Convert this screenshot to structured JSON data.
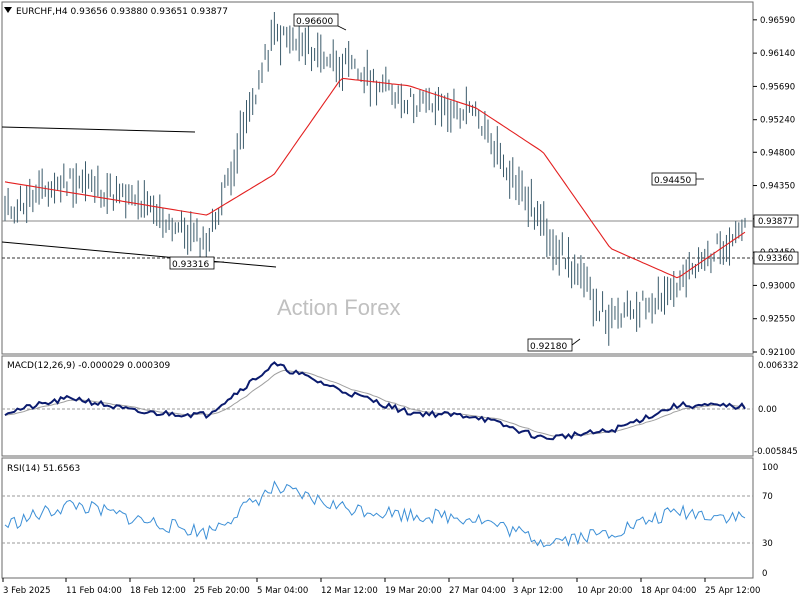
{
  "colors": {
    "price": "#3a5a6a",
    "ma": "#e32020",
    "macd": "#0b1b6e",
    "signal": "#a0a0a0",
    "rsi": "#3c8fd6",
    "trendline": "#000000",
    "refline": "#8a8a8a",
    "border": "#6a6a6a"
  },
  "header": {
    "symbol_line": "EURCHF,H4  0.93656 0.93880 0.93651 0.93877"
  },
  "watermark": "Action Forex",
  "price_axis": {
    "ticks": [
      "0.96590",
      "0.96140",
      "0.95690",
      "0.95240",
      "0.94800",
      "0.94350",
      "0.93900",
      "0.93450",
      "0.93000",
      "0.92550",
      "0.92100"
    ]
  },
  "annotations": {
    "high1": "0.96600",
    "high2": "0.94450",
    "low1": "0.93316",
    "low2": "0.92180",
    "current": "0.93877",
    "level": "0.93360"
  },
  "macd": {
    "label": "MACD(12,26,9) -0.000029 0.000309",
    "ticks": [
      "0.006332",
      "0.00",
      "-0.005845"
    ]
  },
  "rsi": {
    "label": "RSI(14) 51.6563",
    "ticks": [
      "100",
      "70",
      "30",
      "0"
    ]
  },
  "time_axis": {
    "ticks": [
      "3 Feb 2025",
      "11 Feb 04:00",
      "18 Feb 12:00",
      "25 Feb 20:00",
      "5 Mar 04:00",
      "12 Mar 12:00",
      "19 Mar 20:00",
      "27 Mar 04:00",
      "3 Apr 12:00",
      "10 Apr 20:00",
      "18 Apr 04:00",
      "25 Apr 12:00"
    ]
  },
  "chart_data": {
    "type": "line",
    "title": "EURCHF,H4",
    "x": [
      "3 Feb 2025",
      "11 Feb 04:00",
      "18 Feb 12:00",
      "25 Feb 20:00",
      "5 Mar 04:00",
      "12 Mar 12:00",
      "19 Mar 20:00",
      "27 Mar 04:00",
      "3 Apr 12:00",
      "10 Apr 20:00",
      "18 Apr 04:00",
      "25 Apr 12:00"
    ],
    "ylim": [
      0.921,
      0.9675
    ],
    "series": [
      {
        "values": [
          0.94,
          0.9445,
          0.941,
          0.9355,
          0.964,
          0.96,
          0.955,
          0.953,
          0.938,
          0.925,
          0.93,
          0.9385
        ]
      }
    ],
    "ma_values": [
      0.944,
      0.9425,
      0.941,
      0.9395,
      0.945,
      0.958,
      0.957,
      0.954,
      0.948,
      0.935,
      0.931,
      0.9372
    ],
    "macd_values": [
      -0.0005,
      0.0015,
      -0.0005,
      -0.0008,
      0.006,
      0.0025,
      -0.0005,
      -0.001,
      -0.004,
      -0.003,
      0.0005,
      0.0003
    ],
    "rsi_values": [
      45,
      65,
      50,
      38,
      80,
      62,
      55,
      52,
      30,
      38,
      58,
      52
    ],
    "grid": false
  }
}
